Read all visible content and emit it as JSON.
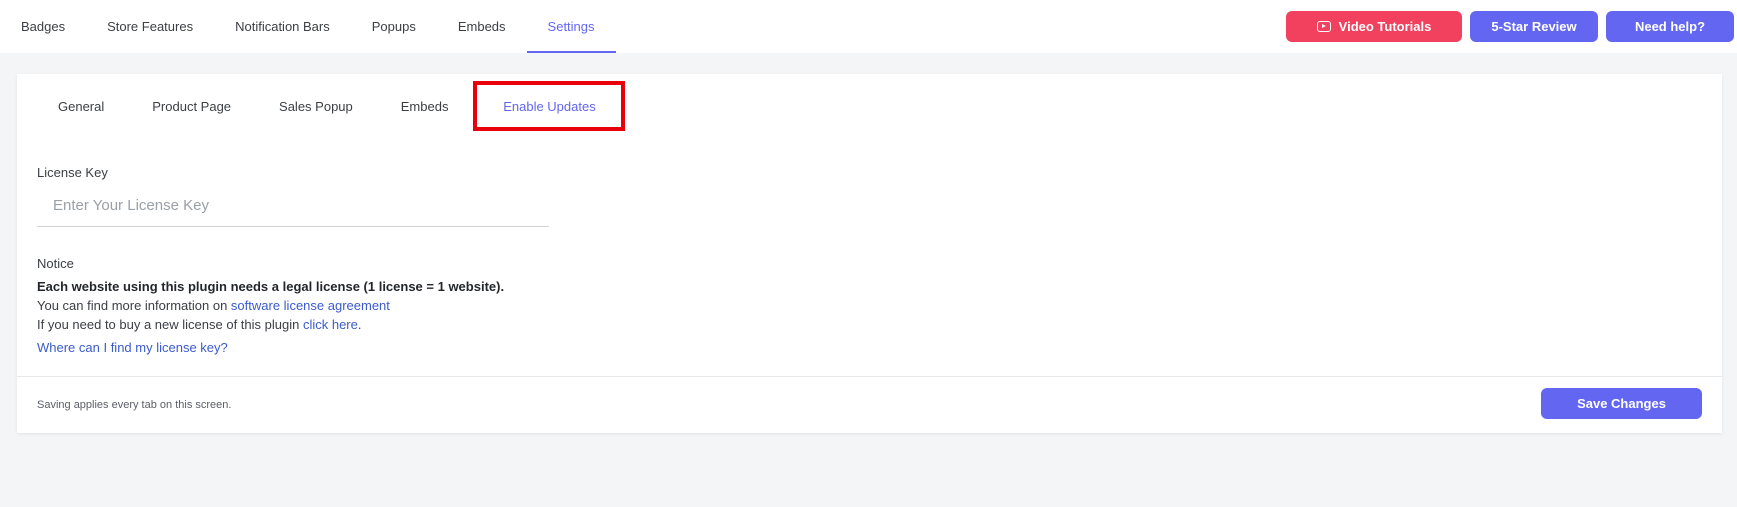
{
  "top_nav": {
    "items": [
      {
        "label": "Badges"
      },
      {
        "label": "Store Features"
      },
      {
        "label": "Notification Bars"
      },
      {
        "label": "Popups"
      },
      {
        "label": "Embeds"
      },
      {
        "label": "Settings",
        "active": true
      }
    ]
  },
  "header_actions": {
    "video_tutorials": "Video Tutorials",
    "five_star_review": "5-Star Review",
    "need_help": "Need help?"
  },
  "settings_tabs": {
    "items": [
      {
        "label": "General"
      },
      {
        "label": "Product Page"
      },
      {
        "label": "Sales Popup"
      },
      {
        "label": "Embeds"
      },
      {
        "label": "Enable Updates",
        "active": true
      }
    ]
  },
  "license": {
    "label": "License Key",
    "placeholder": "Enter Your License Key",
    "value": ""
  },
  "notice": {
    "title": "Notice",
    "bold_line": "Each website using this plugin needs a legal license (1 license = 1 website).",
    "info_prefix": "You can find more information on ",
    "info_link": "software license agreement",
    "buy_prefix": "If you need to buy a new license of this plugin ",
    "buy_link": "click here",
    "buy_suffix": ".",
    "faq_link": "Where can I find my license key?"
  },
  "footer": {
    "note": "Saving applies every tab on this screen.",
    "save_label": "Save Changes"
  },
  "colors": {
    "accent": "#6366f1",
    "danger": "#f2415f",
    "highlight_box": "#e8000b",
    "link": "#3b5bcc",
    "page_background": "#f3f5f7"
  },
  "icons": {
    "video": "youtube-play-icon"
  }
}
